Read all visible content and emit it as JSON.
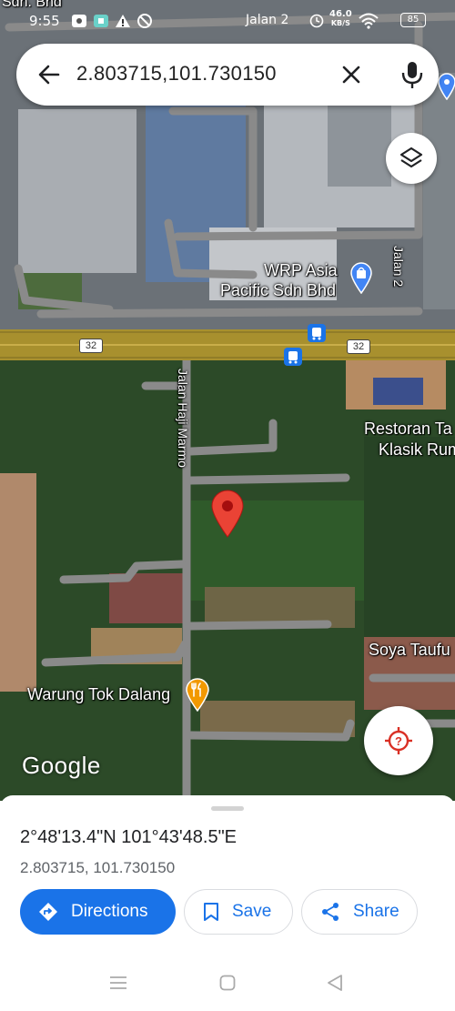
{
  "status_bar": {
    "time": "9:55",
    "current_street": "Jalan 2",
    "network_speed_value": "46.0",
    "network_speed_unit": "KB/S",
    "battery_level": "85",
    "icons": [
      "notification-icon",
      "app-icon",
      "warning-icon",
      "lock-icon",
      "alarm-icon",
      "wifi-icon",
      "battery-icon"
    ]
  },
  "search": {
    "query": "2.803715,101.730150",
    "back_icon": "arrow-left-icon",
    "clear_icon": "close-icon",
    "mic_icon": "microphone-icon"
  },
  "map": {
    "labels": {
      "top_fragment": "Sdn. Bhd",
      "wrp_line1": "WRP Asia",
      "wrp_line2": "Pacific Sdn Bhd",
      "jalan2": "Jalan 2",
      "route_left": "32",
      "route_right": "32",
      "jalan_haji": "Jalan Haji Marmo",
      "restoran_line1": "Restoran Ta",
      "restoran_line2": "Klasik Rum",
      "soya": "Soya Taufu",
      "warung": "Warung Tok Dalang",
      "google": "Google"
    },
    "colors": {
      "road": "#8a8a8a",
      "highway": "#a8902e",
      "pin": "#ea4335",
      "place_blue": "#4285f4",
      "restaurant_orange": "#f29900"
    }
  },
  "sheet": {
    "dms": "2°48'13.4\"N 101°43'48.5\"E",
    "decimal": "2.803715, 101.730150",
    "directions_label": "Directions",
    "save_label": "Save",
    "share_label": "Share",
    "accent": "#1a73e8"
  }
}
